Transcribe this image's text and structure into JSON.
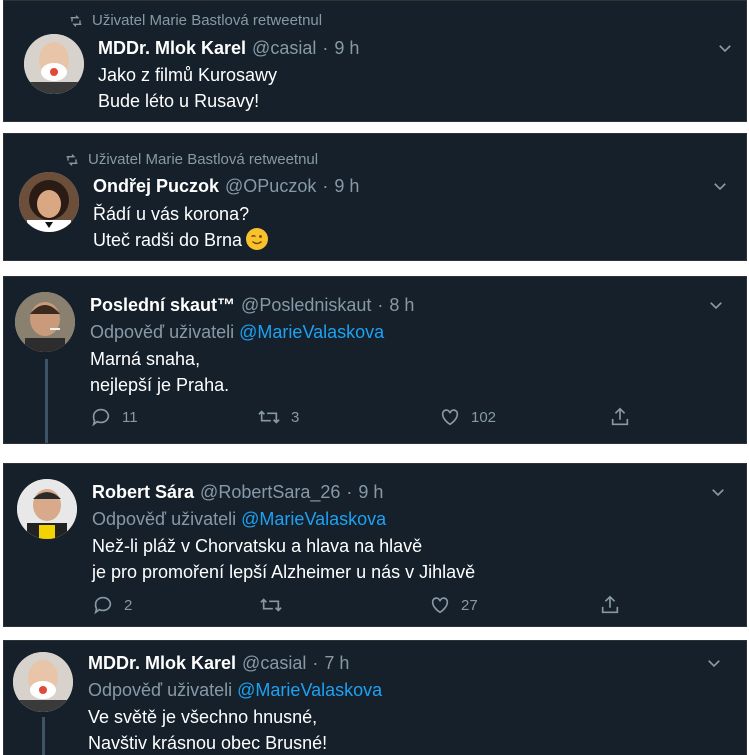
{
  "tweets": [
    {
      "retweet_text": "Uživatel Marie Bastlová retweetnul",
      "name": "MDDr. Mlok Karel",
      "handle": "@casial",
      "time": "9 h",
      "lines": [
        "Jako z filmů Kurosawy",
        "Bude léto u Rusavy!"
      ]
    },
    {
      "retweet_text": "Uživatel Marie Bastlová retweetnul",
      "name": "Ondřej Puczok",
      "handle": "@OPuczok",
      "time": "9 h",
      "lines": [
        "Řádí u vás korona?",
        "Uteč radši do Brna"
      ]
    },
    {
      "name": "Poslední skaut™",
      "handle": "@Posledniskaut",
      "time": "8 h",
      "reply_prefix": "Odpověď uživateli",
      "reply_to": "@MarieValaskova",
      "lines": [
        "Marná snaha,",
        "nejlepší je Praha."
      ],
      "replies": "11",
      "retweets": "3",
      "likes": "102"
    },
    {
      "name": "Robert Sára",
      "handle": "@RobertSara_26",
      "time": "9 h",
      "reply_prefix": "Odpověď uživateli",
      "reply_to": "@MarieValaskova",
      "lines": [
        "Než-li pláž v Chorvatsku a hlava na hlavě",
        "je pro promoření lepší Alzheimer u nás v Jihlavě"
      ],
      "replies": "2",
      "retweets": "",
      "likes": "27"
    },
    {
      "name": "MDDr. Mlok Karel",
      "handle": "@casial",
      "time": "7 h",
      "reply_prefix": "Odpověď uživateli",
      "reply_to": "@MarieValaskova",
      "lines": [
        "Ve světě je všechno hnusné,",
        "Navštiv krásnou obec Brusné!"
      ]
    }
  ],
  "dot": "·",
  "colors": {
    "bg": "#15202b",
    "accent": "#1da1f2",
    "muted": "#8899a6",
    "emoji": "#f9c12e"
  },
  "icons": [
    "retweet-icon",
    "chevron-down-icon",
    "reply-icon",
    "like-icon",
    "share-icon",
    "wink-emoji-icon"
  ]
}
